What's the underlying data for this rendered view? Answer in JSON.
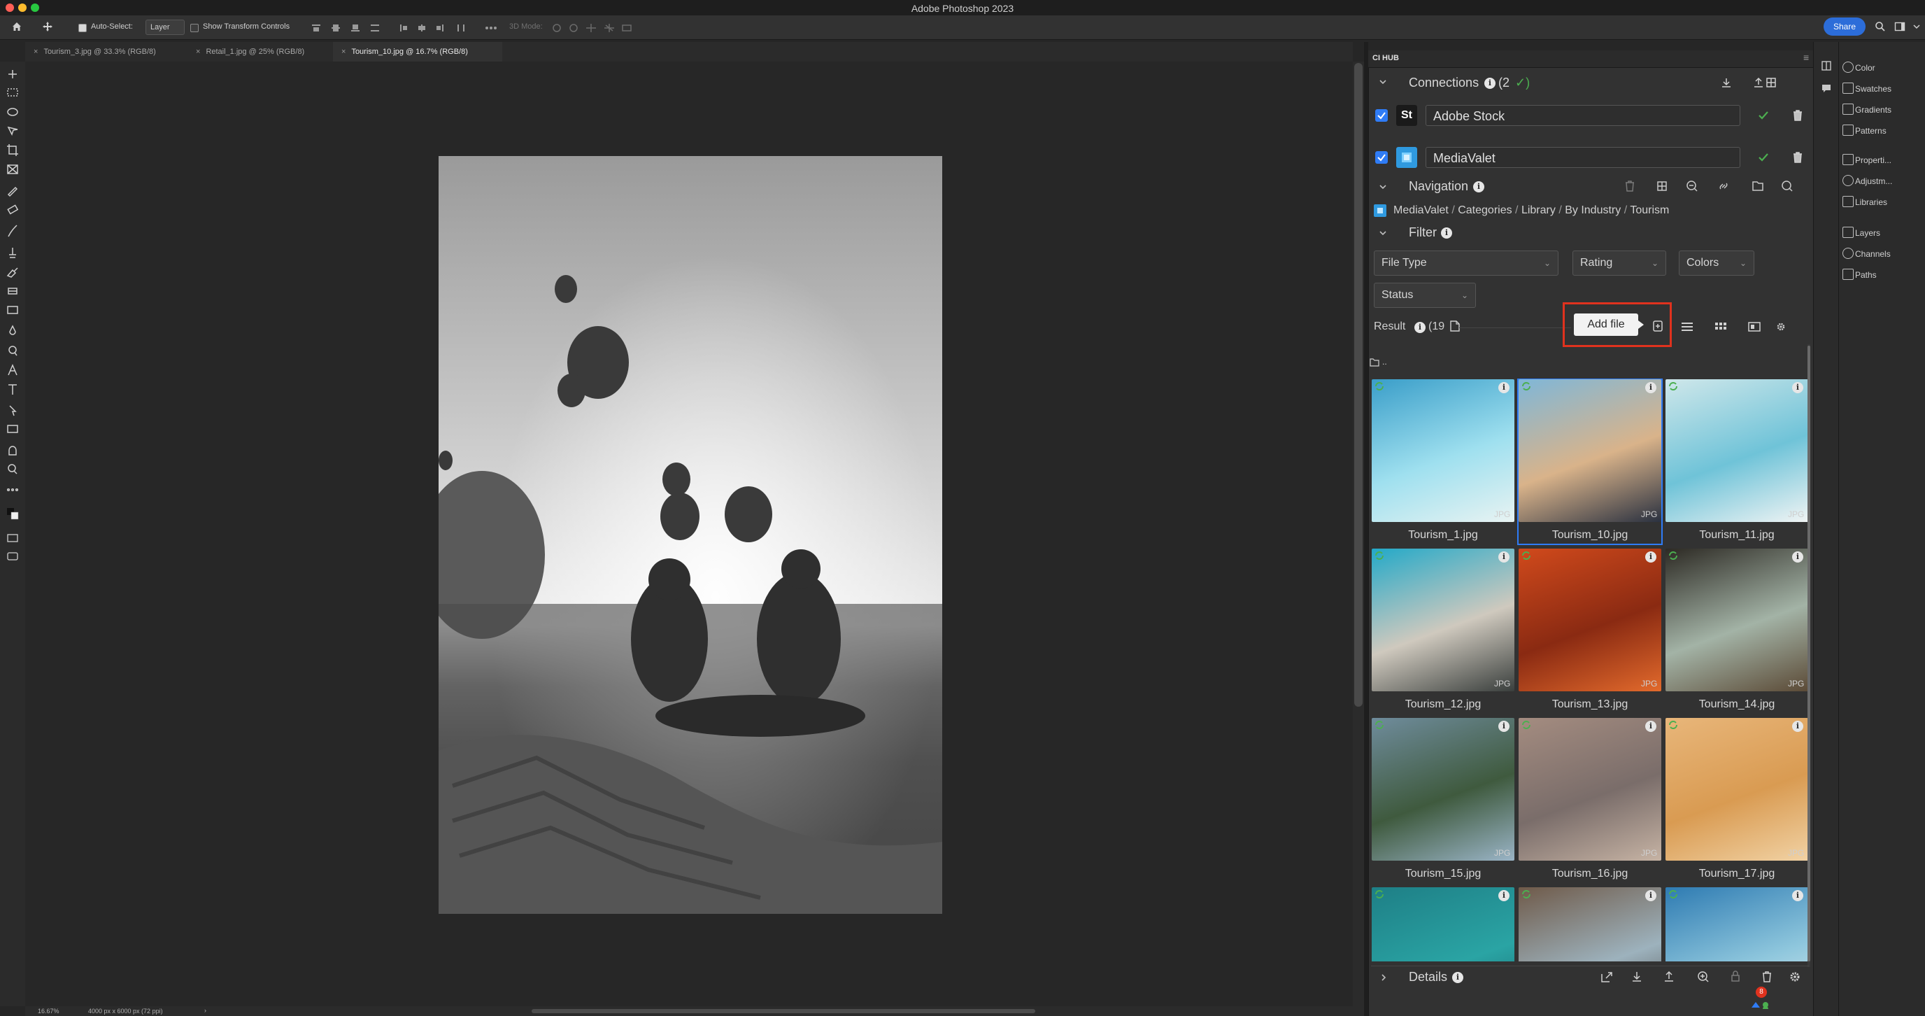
{
  "app": {
    "title": "Adobe Photoshop 2023"
  },
  "options_bar": {
    "auto_select_label": "Auto-Select:",
    "auto_select_value": "Layer",
    "show_transform_label": "Show Transform Controls",
    "mode_label": "3D Mode:",
    "share_label": "Share"
  },
  "tabs": [
    {
      "label": "Tourism_3.jpg @ 33.3% (RGB/8)",
      "active": false
    },
    {
      "label": "Retail_1.jpg @ 25% (RGB/8)",
      "active": false
    },
    {
      "label": "Tourism_10.jpg @ 16.7% (RGB/8)",
      "active": true
    }
  ],
  "status_bar": {
    "zoom": "16.67%",
    "doc_info": "4000 px x 6000 px (72 ppi)",
    "arrow": "›"
  },
  "ci_hub": {
    "panel_title": "CI HUB",
    "connections": {
      "label": "Connections",
      "count": "(2",
      "check": "✓)"
    },
    "services": [
      {
        "badge": "St",
        "name": "Adobe Stock"
      },
      {
        "badge": "",
        "name": "MediaValet"
      }
    ],
    "navigation": {
      "label": "Navigation"
    },
    "breadcrumb": {
      "root": "MediaValet",
      "sep": "/",
      "parts": [
        "Categories",
        "Library",
        "By Industry",
        "Tourism"
      ]
    },
    "filter": {
      "label": "Filter",
      "file_type": "File Type",
      "rating": "Rating",
      "colors": "Colors",
      "status": "Status"
    },
    "result": {
      "label": "Result",
      "count": "(19"
    },
    "tooltip": "Add file",
    "parent_folder": "..",
    "files": [
      {
        "name": "Tourism_1.jpg",
        "type": "JPG",
        "colors": [
          "#3a9ec9",
          "#9fe0ef",
          "#e8f3f2"
        ]
      },
      {
        "name": "Tourism_10.jpg",
        "type": "JPG",
        "colors": [
          "#7fb7d8",
          "#d9b38a",
          "#2a3140"
        ]
      },
      {
        "name": "Tourism_11.jpg",
        "type": "JPG",
        "colors": [
          "#cfe7ea",
          "#6fc3d8",
          "#f0f4f4"
        ]
      },
      {
        "name": "Tourism_12.jpg",
        "type": "JPG",
        "colors": [
          "#23a9c8",
          "#cfc9be",
          "#3a3f3d"
        ]
      },
      {
        "name": "Tourism_13.jpg",
        "type": "JPG",
        "colors": [
          "#d14a1c",
          "#8a2a12",
          "#e26a2c"
        ]
      },
      {
        "name": "Tourism_14.jpg",
        "type": "JPG",
        "colors": [
          "#2d2a24",
          "#a3b3a6",
          "#5b4a36"
        ]
      },
      {
        "name": "Tourism_15.jpg",
        "type": "JPG",
        "colors": [
          "#6f8c9c",
          "#3f5a3e",
          "#9ab4c6"
        ]
      },
      {
        "name": "Tourism_16.jpg",
        "type": "JPG",
        "colors": [
          "#a48c80",
          "#7a6d6a",
          "#c6b3a4"
        ]
      },
      {
        "name": "Tourism_17.jpg",
        "type": "JPG",
        "colors": [
          "#e8b67a",
          "#d99b52",
          "#f1d2a4"
        ]
      },
      {
        "name": "",
        "type": "",
        "colors": [
          "#1e7f86",
          "#2aa4a4",
          "#145e66"
        ]
      },
      {
        "name": "",
        "type": "",
        "colors": [
          "#6f5a49",
          "#9db2bd",
          "#3e3a36"
        ]
      },
      {
        "name": "",
        "type": "",
        "colors": [
          "#2e7bb2",
          "#8fc7dd",
          "#e8f2f2"
        ]
      }
    ],
    "details": {
      "label": "Details"
    },
    "notification_count": "8"
  },
  "right_panels": [
    "Color",
    "Swatches",
    "Gradients",
    "Patterns",
    "Properti...",
    "Adjustm...",
    "Libraries",
    "Layers",
    "Channels",
    "Paths"
  ],
  "accent": {
    "blue": "#2f7cf6",
    "green": "#4caf50",
    "highlight": "#e0321e"
  }
}
